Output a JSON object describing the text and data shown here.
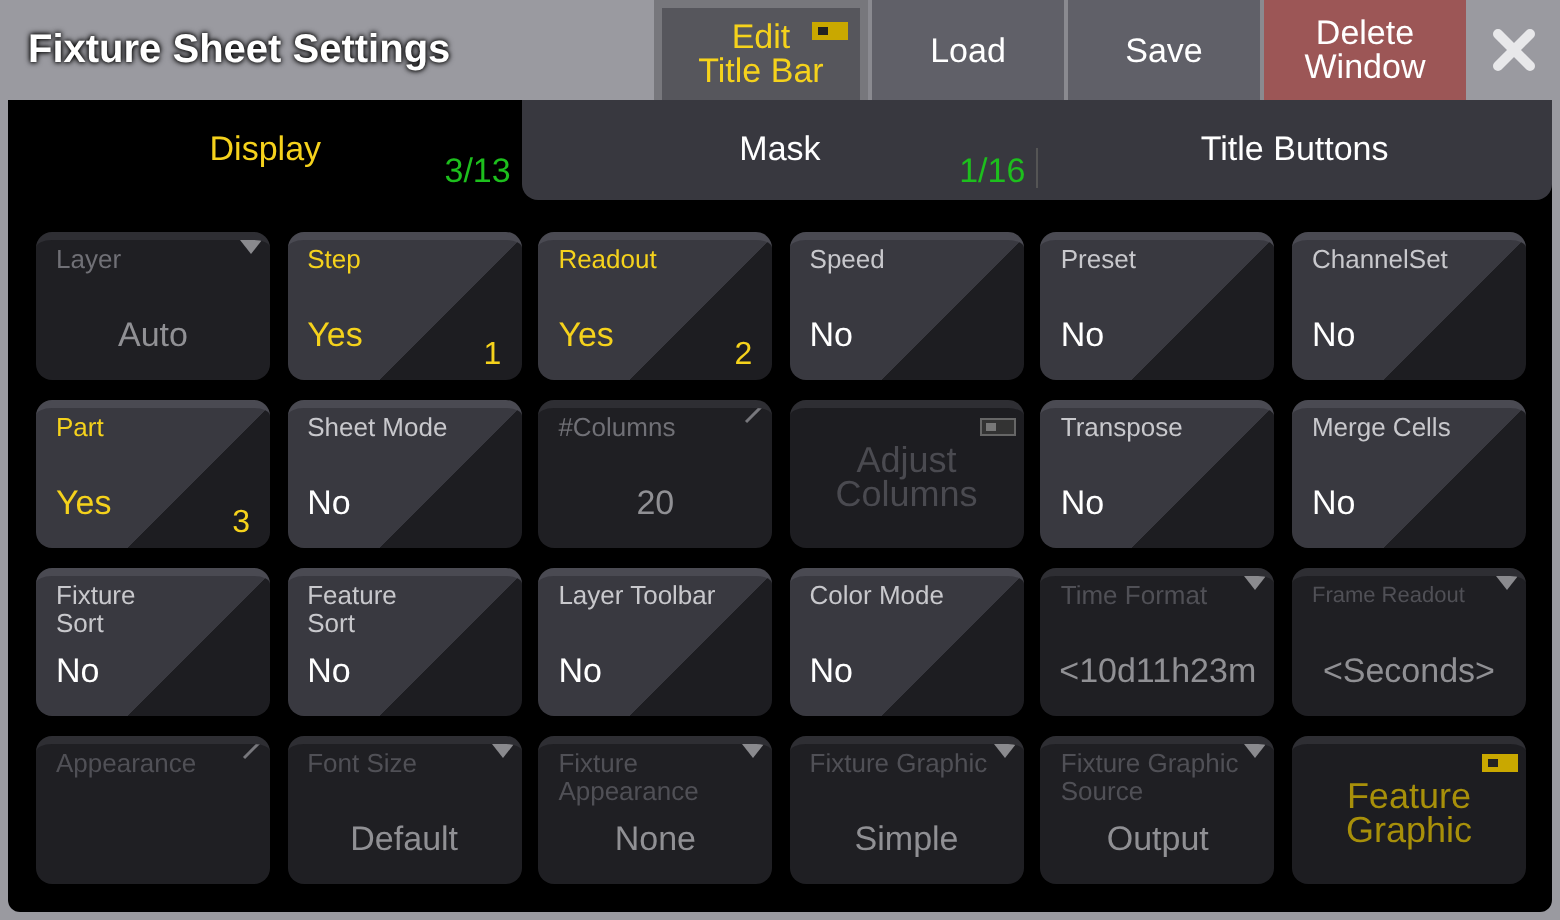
{
  "window": {
    "title": "Fixture Sheet Settings"
  },
  "title_buttons": [
    {
      "label": "Edit\nTitle Bar",
      "kind": "switch",
      "on": true
    },
    {
      "label": "Load",
      "kind": "plain"
    },
    {
      "label": "Save",
      "kind": "plain"
    },
    {
      "label": "Delete\nWindow",
      "kind": "danger"
    }
  ],
  "tabs": [
    {
      "label": "Display",
      "count": "3/13",
      "selected": true
    },
    {
      "label": "Mask",
      "count": "1/16",
      "selected": false
    },
    {
      "label": "Title Buttons",
      "selected": false
    }
  ],
  "cells": [
    {
      "kind": "select",
      "label": "Layer",
      "value": "Auto",
      "dropdown": true,
      "enabled": true
    },
    {
      "kind": "toggle",
      "label": "Step",
      "value": "Yes",
      "active": true,
      "number": "1"
    },
    {
      "kind": "toggle",
      "label": "Readout",
      "value": "Yes",
      "active": true,
      "number": "2"
    },
    {
      "kind": "toggle",
      "label": "Speed",
      "value": "No",
      "active": false
    },
    {
      "kind": "toggle",
      "label": "Preset",
      "value": "No",
      "active": false
    },
    {
      "kind": "toggle",
      "label": "ChannelSet",
      "value": "No",
      "active": false
    },
    {
      "kind": "toggle",
      "label": "Part",
      "value": "Yes",
      "active": true,
      "number": "3"
    },
    {
      "kind": "toggle",
      "label": "Sheet Mode",
      "value": "No",
      "active": false
    },
    {
      "kind": "select",
      "label": "#Columns",
      "value": "20",
      "editable": true,
      "enabled": true
    },
    {
      "kind": "button",
      "label": "Adjust\nColumns",
      "on": false
    },
    {
      "kind": "toggle",
      "label": "Transpose",
      "value": "No",
      "active": false
    },
    {
      "kind": "toggle",
      "label": "Merge Cells",
      "value": "No",
      "active": false
    },
    {
      "kind": "toggle",
      "label": "Fixture\nSort",
      "value": "No",
      "active": false
    },
    {
      "kind": "toggle",
      "label": "Feature\nSort",
      "value": "No",
      "active": false
    },
    {
      "kind": "toggle",
      "label": "Layer Toolbar",
      "value": "No",
      "active": false
    },
    {
      "kind": "toggle",
      "label": "Color Mode",
      "value": "No",
      "active": false
    },
    {
      "kind": "select",
      "label": "Time Format",
      "value": "<10d11h23m",
      "dropdown": true,
      "enabled": false
    },
    {
      "kind": "select",
      "label": "Frame Readout",
      "value": "<Seconds>",
      "dropdown": true,
      "enabled": false,
      "small_label": true
    },
    {
      "kind": "select",
      "label": "Appearance",
      "editable": true,
      "enabled": false
    },
    {
      "kind": "select",
      "label": "Font Size",
      "value": "Default",
      "dropdown": true,
      "enabled": false
    },
    {
      "kind": "select",
      "label": "Fixture\nAppearance",
      "value": "None",
      "dropdown": true,
      "enabled": false
    },
    {
      "kind": "select",
      "label": "Fixture Graphic",
      "value": "Simple",
      "dropdown": true,
      "enabled": false
    },
    {
      "kind": "select",
      "label": "Fixture Graphic\nSource",
      "value": "Output",
      "dropdown": true,
      "enabled": false
    },
    {
      "kind": "button",
      "label": "Feature\nGraphic",
      "on": true
    }
  ]
}
